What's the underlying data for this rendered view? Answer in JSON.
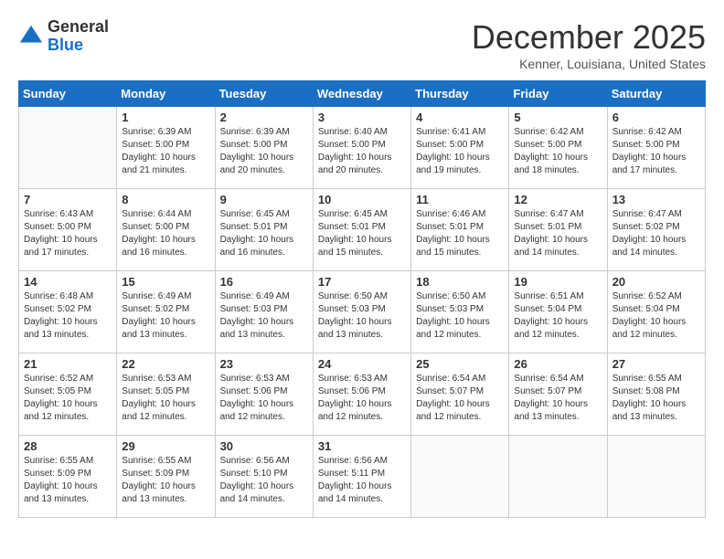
{
  "header": {
    "logo_general": "General",
    "logo_blue": "Blue",
    "month_title": "December 2025",
    "location": "Kenner, Louisiana, United States"
  },
  "weekdays": [
    "Sunday",
    "Monday",
    "Tuesday",
    "Wednesday",
    "Thursday",
    "Friday",
    "Saturday"
  ],
  "weeks": [
    [
      {
        "day": "",
        "sunrise": "",
        "sunset": "",
        "daylight": ""
      },
      {
        "day": "1",
        "sunrise": "Sunrise: 6:39 AM",
        "sunset": "Sunset: 5:00 PM",
        "daylight": "Daylight: 10 hours and 21 minutes."
      },
      {
        "day": "2",
        "sunrise": "Sunrise: 6:39 AM",
        "sunset": "Sunset: 5:00 PM",
        "daylight": "Daylight: 10 hours and 20 minutes."
      },
      {
        "day": "3",
        "sunrise": "Sunrise: 6:40 AM",
        "sunset": "Sunset: 5:00 PM",
        "daylight": "Daylight: 10 hours and 20 minutes."
      },
      {
        "day": "4",
        "sunrise": "Sunrise: 6:41 AM",
        "sunset": "Sunset: 5:00 PM",
        "daylight": "Daylight: 10 hours and 19 minutes."
      },
      {
        "day": "5",
        "sunrise": "Sunrise: 6:42 AM",
        "sunset": "Sunset: 5:00 PM",
        "daylight": "Daylight: 10 hours and 18 minutes."
      },
      {
        "day": "6",
        "sunrise": "Sunrise: 6:42 AM",
        "sunset": "Sunset: 5:00 PM",
        "daylight": "Daylight: 10 hours and 17 minutes."
      }
    ],
    [
      {
        "day": "7",
        "sunrise": "Sunrise: 6:43 AM",
        "sunset": "Sunset: 5:00 PM",
        "daylight": "Daylight: 10 hours and 17 minutes."
      },
      {
        "day": "8",
        "sunrise": "Sunrise: 6:44 AM",
        "sunset": "Sunset: 5:00 PM",
        "daylight": "Daylight: 10 hours and 16 minutes."
      },
      {
        "day": "9",
        "sunrise": "Sunrise: 6:45 AM",
        "sunset": "Sunset: 5:01 PM",
        "daylight": "Daylight: 10 hours and 16 minutes."
      },
      {
        "day": "10",
        "sunrise": "Sunrise: 6:45 AM",
        "sunset": "Sunset: 5:01 PM",
        "daylight": "Daylight: 10 hours and 15 minutes."
      },
      {
        "day": "11",
        "sunrise": "Sunrise: 6:46 AM",
        "sunset": "Sunset: 5:01 PM",
        "daylight": "Daylight: 10 hours and 15 minutes."
      },
      {
        "day": "12",
        "sunrise": "Sunrise: 6:47 AM",
        "sunset": "Sunset: 5:01 PM",
        "daylight": "Daylight: 10 hours and 14 minutes."
      },
      {
        "day": "13",
        "sunrise": "Sunrise: 6:47 AM",
        "sunset": "Sunset: 5:02 PM",
        "daylight": "Daylight: 10 hours and 14 minutes."
      }
    ],
    [
      {
        "day": "14",
        "sunrise": "Sunrise: 6:48 AM",
        "sunset": "Sunset: 5:02 PM",
        "daylight": "Daylight: 10 hours and 13 minutes."
      },
      {
        "day": "15",
        "sunrise": "Sunrise: 6:49 AM",
        "sunset": "Sunset: 5:02 PM",
        "daylight": "Daylight: 10 hours and 13 minutes."
      },
      {
        "day": "16",
        "sunrise": "Sunrise: 6:49 AM",
        "sunset": "Sunset: 5:03 PM",
        "daylight": "Daylight: 10 hours and 13 minutes."
      },
      {
        "day": "17",
        "sunrise": "Sunrise: 6:50 AM",
        "sunset": "Sunset: 5:03 PM",
        "daylight": "Daylight: 10 hours and 13 minutes."
      },
      {
        "day": "18",
        "sunrise": "Sunrise: 6:50 AM",
        "sunset": "Sunset: 5:03 PM",
        "daylight": "Daylight: 10 hours and 12 minutes."
      },
      {
        "day": "19",
        "sunrise": "Sunrise: 6:51 AM",
        "sunset": "Sunset: 5:04 PM",
        "daylight": "Daylight: 10 hours and 12 minutes."
      },
      {
        "day": "20",
        "sunrise": "Sunrise: 6:52 AM",
        "sunset": "Sunset: 5:04 PM",
        "daylight": "Daylight: 10 hours and 12 minutes."
      }
    ],
    [
      {
        "day": "21",
        "sunrise": "Sunrise: 6:52 AM",
        "sunset": "Sunset: 5:05 PM",
        "daylight": "Daylight: 10 hours and 12 minutes."
      },
      {
        "day": "22",
        "sunrise": "Sunrise: 6:53 AM",
        "sunset": "Sunset: 5:05 PM",
        "daylight": "Daylight: 10 hours and 12 minutes."
      },
      {
        "day": "23",
        "sunrise": "Sunrise: 6:53 AM",
        "sunset": "Sunset: 5:06 PM",
        "daylight": "Daylight: 10 hours and 12 minutes."
      },
      {
        "day": "24",
        "sunrise": "Sunrise: 6:53 AM",
        "sunset": "Sunset: 5:06 PM",
        "daylight": "Daylight: 10 hours and 12 minutes."
      },
      {
        "day": "25",
        "sunrise": "Sunrise: 6:54 AM",
        "sunset": "Sunset: 5:07 PM",
        "daylight": "Daylight: 10 hours and 12 minutes."
      },
      {
        "day": "26",
        "sunrise": "Sunrise: 6:54 AM",
        "sunset": "Sunset: 5:07 PM",
        "daylight": "Daylight: 10 hours and 13 minutes."
      },
      {
        "day": "27",
        "sunrise": "Sunrise: 6:55 AM",
        "sunset": "Sunset: 5:08 PM",
        "daylight": "Daylight: 10 hours and 13 minutes."
      }
    ],
    [
      {
        "day": "28",
        "sunrise": "Sunrise: 6:55 AM",
        "sunset": "Sunset: 5:09 PM",
        "daylight": "Daylight: 10 hours and 13 minutes."
      },
      {
        "day": "29",
        "sunrise": "Sunrise: 6:55 AM",
        "sunset": "Sunset: 5:09 PM",
        "daylight": "Daylight: 10 hours and 13 minutes."
      },
      {
        "day": "30",
        "sunrise": "Sunrise: 6:56 AM",
        "sunset": "Sunset: 5:10 PM",
        "daylight": "Daylight: 10 hours and 14 minutes."
      },
      {
        "day": "31",
        "sunrise": "Sunrise: 6:56 AM",
        "sunset": "Sunset: 5:11 PM",
        "daylight": "Daylight: 10 hours and 14 minutes."
      },
      {
        "day": "",
        "sunrise": "",
        "sunset": "",
        "daylight": ""
      },
      {
        "day": "",
        "sunrise": "",
        "sunset": "",
        "daylight": ""
      },
      {
        "day": "",
        "sunrise": "",
        "sunset": "",
        "daylight": ""
      }
    ]
  ]
}
